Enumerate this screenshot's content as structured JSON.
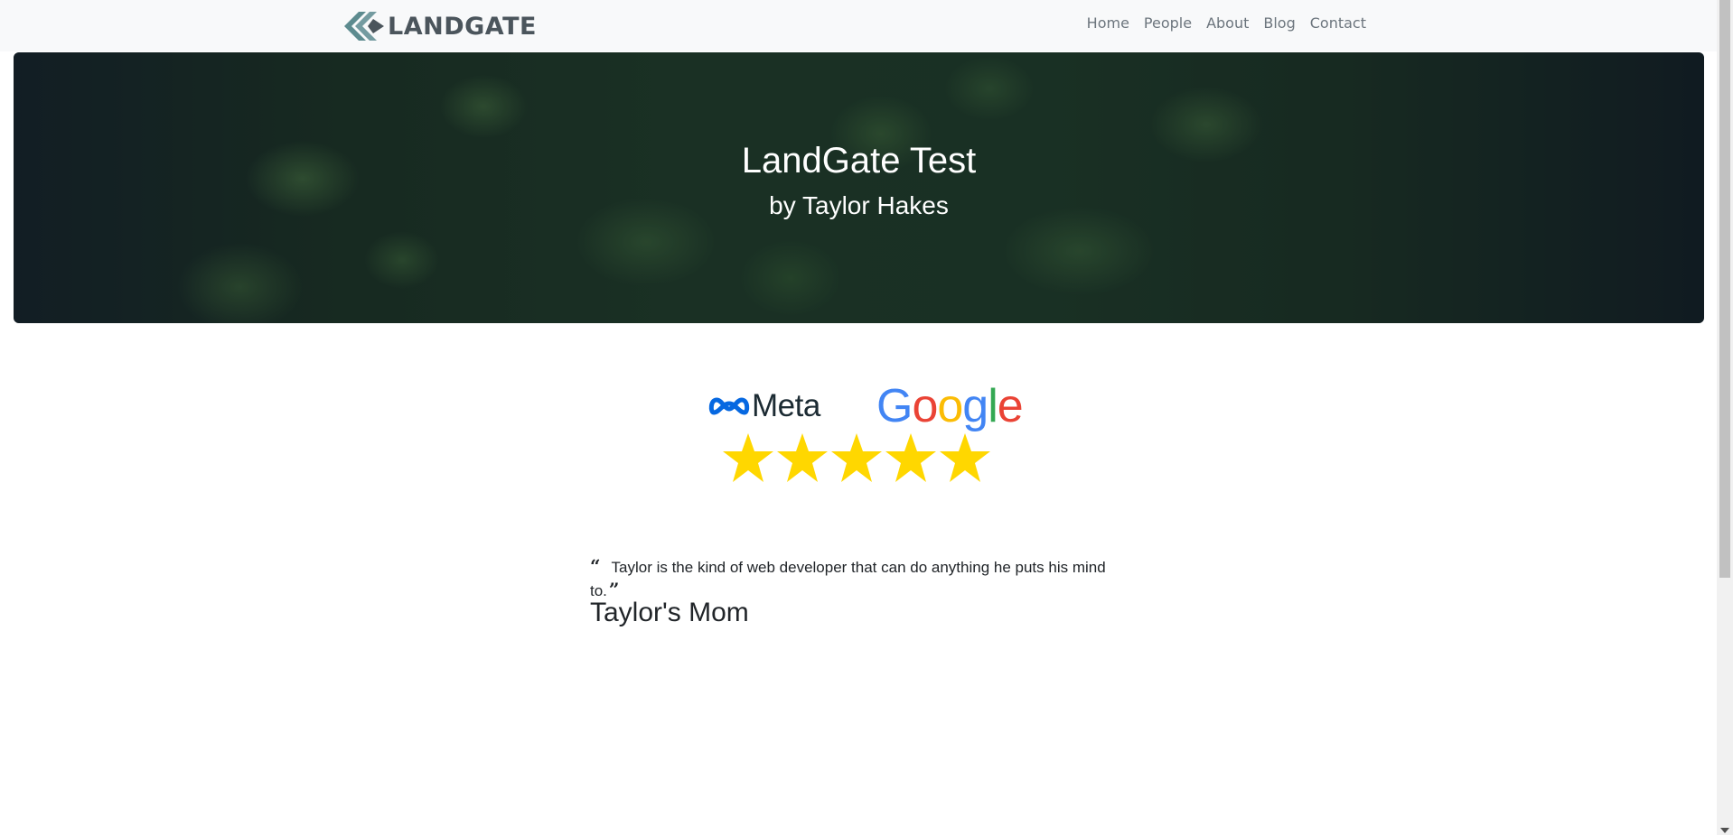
{
  "navbar": {
    "brand": "LANDGATE",
    "links": [
      "Home",
      "People",
      "About",
      "Blog",
      "Contact"
    ],
    "brand_color": "#4b555c",
    "logo_icon_color": "#5d8b8f"
  },
  "hero": {
    "title": "LandGate Test",
    "subtitle": "by Taylor Hakes"
  },
  "logos": {
    "meta": "Meta",
    "google": [
      "G",
      "o",
      "o",
      "g",
      "l",
      "e"
    ]
  },
  "rating": {
    "stars": 5,
    "max": 5,
    "star_color": "#ffd700"
  },
  "testimonial": {
    "quote": "Taylor is the kind of web developer that can do anything he puts his mind to.",
    "author": "Taylor's Mom"
  }
}
